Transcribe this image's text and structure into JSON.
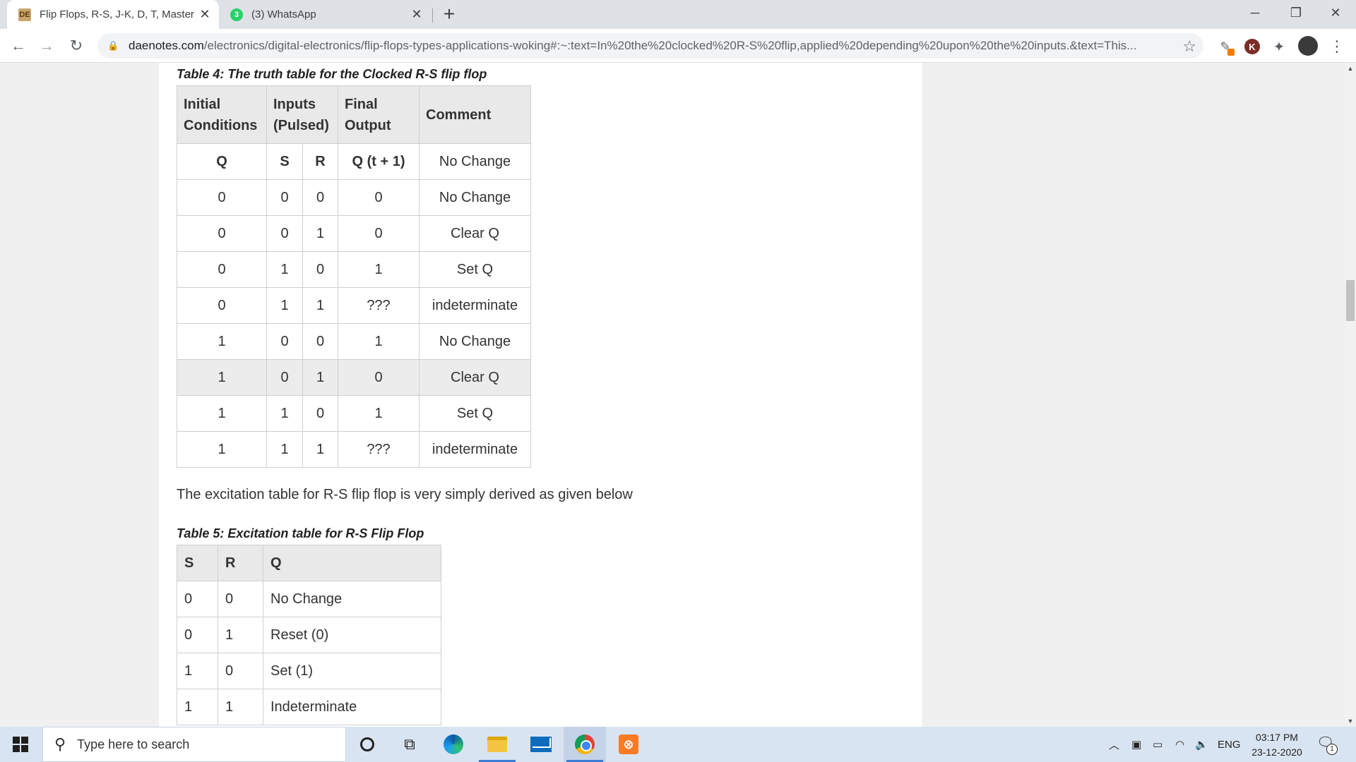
{
  "browser": {
    "tabs": [
      {
        "title": "Flip Flops, R-S, J-K, D, T, Master S",
        "icon": "daenotes-favicon",
        "active": true
      },
      {
        "title": "(3) WhatsApp",
        "icon": "whatsapp-favicon",
        "badge": "3",
        "active": false
      }
    ],
    "new_tab_label": "+",
    "window_controls": {
      "minimize": "─",
      "restore": "❐",
      "close": "✕"
    },
    "url_host": "daenotes.com",
    "url_path": "/electronics/digital-electronics/flip-flops-types-applications-woking#:~:text=In%20the%20clocked%20R-S%20flip,applied%20depending%20upon%20the%20inputs.&text=This...",
    "extensions": {
      "k_avatar": "K"
    }
  },
  "page": {
    "table4": {
      "caption": "Table 4: The truth table for the Clocked R-S flip flop",
      "headers": [
        "Initial Conditions",
        "Inputs (Pulsed)",
        "Final Output",
        "Comment"
      ],
      "subheader": [
        "Q",
        "S",
        "R",
        "Q (t + 1)",
        "No Change"
      ],
      "rows": [
        [
          "0",
          "0",
          "0",
          "0",
          "No Change"
        ],
        [
          "0",
          "0",
          "1",
          "0",
          "Clear Q"
        ],
        [
          "0",
          "1",
          "0",
          "1",
          "Set Q"
        ],
        [
          "0",
          "1",
          "1",
          "???",
          "indeterminate"
        ],
        [
          "1",
          "0",
          "0",
          "1",
          "No Change"
        ],
        [
          "1",
          "0",
          "1",
          "0",
          "Clear Q"
        ],
        [
          "1",
          "1",
          "0",
          "1",
          "Set Q"
        ],
        [
          "1",
          "1",
          "1",
          "???",
          "indeterminate"
        ]
      ]
    },
    "paragraph": "The excitation table for R-S flip flop is very simply derived as given below",
    "table5": {
      "caption": "Table 5: Excitation table for R-S Flip Flop",
      "headers": [
        "S",
        "R",
        "Q"
      ],
      "rows": [
        [
          "0",
          "0",
          "No Change"
        ],
        [
          "0",
          "1",
          "Reset (0)"
        ],
        [
          "1",
          "0",
          "Set (1)"
        ],
        [
          "1",
          "1",
          "Indeterminate"
        ]
      ]
    }
  },
  "taskbar": {
    "search_placeholder": "Type here to search",
    "language": "ENG",
    "time": "03:17 PM",
    "date": "23-12-2020",
    "notification_count": "1"
  },
  "colors": {
    "tabstrip": "#dee1e6",
    "table_header_bg": "#e9e9e9",
    "taskbar": "#d9e4f2",
    "accent_blue": "#3a7bd5"
  }
}
